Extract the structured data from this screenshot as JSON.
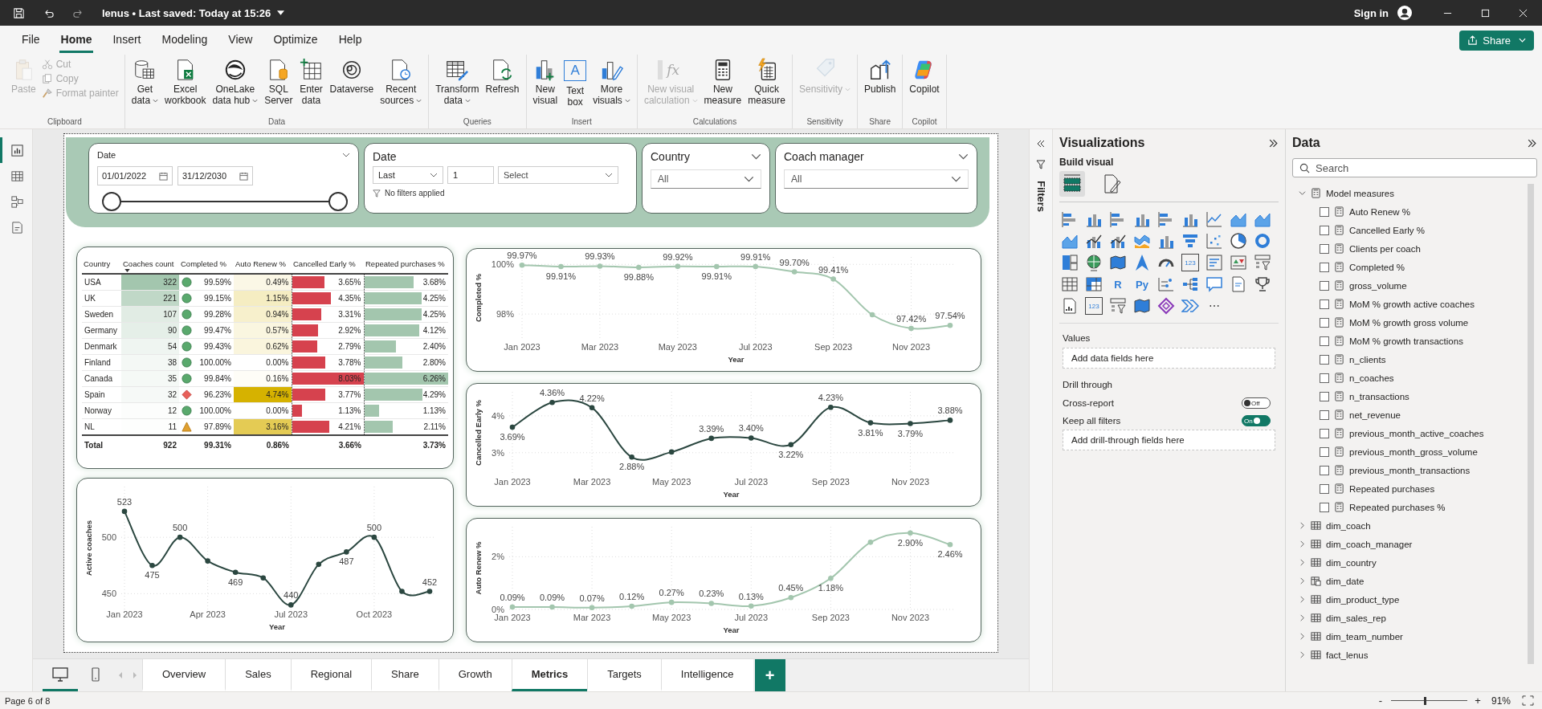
{
  "title_bar": {
    "title": "lenus • Last saved: Today at 15:26",
    "sign_in": "Sign in"
  },
  "menu_tabs": [
    {
      "label": "File",
      "selected": false
    },
    {
      "label": "Home",
      "selected": true
    },
    {
      "label": "Insert",
      "selected": false
    },
    {
      "label": "Modeling",
      "selected": false
    },
    {
      "label": "View",
      "selected": false
    },
    {
      "label": "Optimize",
      "selected": false
    },
    {
      "label": "Help",
      "selected": false
    }
  ],
  "share_button": "Share",
  "ribbon_groups": [
    {
      "label": "Clipboard",
      "buttons": [
        {
          "label": "Paste",
          "kind": "large",
          "disabled": true,
          "dropdown": false
        },
        {
          "label": "Cut",
          "kind": "small",
          "disabled": true,
          "dropdown": false
        },
        {
          "label": "Copy",
          "kind": "small",
          "disabled": true,
          "dropdown": false
        },
        {
          "label": "Format painter",
          "kind": "small",
          "disabled": true,
          "dropdown": false
        }
      ]
    },
    {
      "label": "Data",
      "buttons": [
        {
          "label": "Get\ndata",
          "kind": "large",
          "dropdown": true,
          "disabled": false
        },
        {
          "label": "Excel\nworkbook",
          "kind": "large",
          "dropdown": false,
          "disabled": false
        },
        {
          "label": "OneLake\ndata hub",
          "kind": "large",
          "dropdown": true,
          "disabled": false
        },
        {
          "label": "SQL\nServer",
          "kind": "large",
          "dropdown": false,
          "disabled": false
        },
        {
          "label": "Enter\ndata",
          "kind": "large",
          "dropdown": false,
          "disabled": false
        },
        {
          "label": "Dataverse",
          "kind": "large",
          "dropdown": false,
          "disabled": false
        },
        {
          "label": "Recent\nsources",
          "kind": "large",
          "dropdown": true,
          "disabled": false
        }
      ]
    },
    {
      "label": "Queries",
      "buttons": [
        {
          "label": "Transform\ndata",
          "kind": "large",
          "dropdown": true,
          "disabled": false
        },
        {
          "label": "Refresh",
          "kind": "large",
          "dropdown": false,
          "disabled": false
        }
      ]
    },
    {
      "label": "Insert",
      "buttons": [
        {
          "label": "New\nvisual",
          "kind": "large",
          "dropdown": false,
          "disabled": false
        },
        {
          "label": "Text\nbox",
          "kind": "large",
          "icon_text": "A",
          "dropdown": false,
          "disabled": false
        },
        {
          "label": "More\nvisuals",
          "kind": "large",
          "dropdown": true,
          "disabled": false
        }
      ]
    },
    {
      "label": "Calculations",
      "buttons": [
        {
          "label": "New visual\ncalculation",
          "kind": "large",
          "dropdown": true,
          "disabled": true,
          "icon_text": "fx"
        },
        {
          "label": "New\nmeasure",
          "kind": "large",
          "dropdown": false,
          "disabled": false
        },
        {
          "label": "Quick\nmeasure",
          "kind": "large",
          "dropdown": false,
          "disabled": false
        }
      ]
    },
    {
      "label": "Sensitivity",
      "buttons": [
        {
          "label": "Sensitivity",
          "kind": "large",
          "dropdown": true,
          "disabled": true
        }
      ]
    },
    {
      "label": "Share",
      "buttons": [
        {
          "label": "Publish",
          "kind": "large",
          "dropdown": false,
          "disabled": false
        }
      ]
    },
    {
      "label": "Copilot",
      "buttons": [
        {
          "label": "Copilot",
          "kind": "large",
          "dropdown": false,
          "disabled": false
        }
      ]
    }
  ],
  "view_rail": [
    {
      "selected": true
    },
    {
      "selected": false
    },
    {
      "selected": false
    },
    {
      "selected": false
    }
  ],
  "slicers": [
    {
      "kind": "date_range",
      "title": "Date",
      "start": "01/01/2022",
      "end": "31/12/2030",
      "range": {
        "level": 1
      }
    },
    {
      "kind": "relative_date",
      "title": "Date",
      "period": "Last",
      "count": "1",
      "unit_placeholder": "Select",
      "status": "No filters applied"
    },
    {
      "kind": "dropdown",
      "title": "Country",
      "value": "All"
    },
    {
      "kind": "dropdown",
      "title": "Coach manager",
      "value": "All"
    }
  ],
  "table": {
    "columns": [
      "Country",
      "Coaches count",
      "Completed %",
      "Auto Renew %",
      "Cancelled Early %",
      "Repeated purchases %"
    ],
    "rows": [
      {
        "country": "USA",
        "coaches": {
          "text": "322",
          "color": "#a3c6ae"
        },
        "completed": {
          "kind": "circle",
          "text": "99.59%"
        },
        "auto_renew": {
          "text": "0.49%",
          "color": "#fbf7e6"
        },
        "cancelled": {
          "text": "3.65%",
          "level": 0.45
        },
        "repeated": {
          "text": "3.68%",
          "level": 0.59
        }
      },
      {
        "country": "UK",
        "coaches": {
          "text": "221",
          "color": "#c0d8c7"
        },
        "completed": {
          "kind": "circle",
          "text": "99.15%"
        },
        "auto_renew": {
          "text": "1.15%",
          "color": "#f5edc2"
        },
        "cancelled": {
          "text": "4.35%",
          "level": 0.54
        },
        "repeated": {
          "text": "4.25%",
          "level": 0.68
        }
      },
      {
        "country": "Sweden",
        "coaches": {
          "text": "107",
          "color": "#e1ece4"
        },
        "completed": {
          "kind": "circle",
          "text": "99.28%"
        },
        "auto_renew": {
          "text": "0.94%",
          "color": "#f7f0cc"
        },
        "cancelled": {
          "text": "3.31%",
          "level": 0.41
        },
        "repeated": {
          "text": "4.25%",
          "level": 0.68
        }
      },
      {
        "country": "Germany",
        "coaches": {
          "text": "90",
          "color": "#e5efe8"
        },
        "completed": {
          "kind": "circle",
          "text": "99.47%"
        },
        "auto_renew": {
          "text": "0.57%",
          "color": "#faf6e0"
        },
        "cancelled": {
          "text": "2.92%",
          "level": 0.36
        },
        "repeated": {
          "text": "4.12%",
          "level": 0.66
        }
      },
      {
        "country": "Denmark",
        "coaches": {
          "text": "54",
          "color": "#eff5f1"
        },
        "completed": {
          "kind": "circle",
          "text": "99.43%"
        },
        "auto_renew": {
          "text": "0.62%",
          "color": "#faf5dd"
        },
        "cancelled": {
          "text": "2.79%",
          "level": 0.35
        },
        "repeated": {
          "text": "2.40%",
          "level": 0.38
        }
      },
      {
        "country": "Finland",
        "coaches": {
          "text": "38",
          "color": "#f4f8f5"
        },
        "completed": {
          "kind": "circle",
          "text": "100.00%"
        },
        "auto_renew": {
          "text": "0.00%",
          "color": "#ffffff"
        },
        "cancelled": {
          "text": "3.78%",
          "level": 0.47
        },
        "repeated": {
          "text": "2.80%",
          "level": 0.45
        }
      },
      {
        "country": "Canada",
        "coaches": {
          "text": "35",
          "color": "#f5f9f6"
        },
        "completed": {
          "kind": "circle",
          "text": "99.84%"
        },
        "auto_renew": {
          "text": "0.16%",
          "color": "#fefdf7"
        },
        "cancelled": {
          "text": "8.03%",
          "level": 1
        },
        "repeated": {
          "text": "6.26%",
          "level": 1
        }
      },
      {
        "country": "Spain",
        "coaches": {
          "text": "32",
          "color": "#f6f9f7"
        },
        "completed": {
          "kind": "diamond",
          "text": "96.23%"
        },
        "auto_renew": {
          "text": "4.74%",
          "color": "#d6b200"
        },
        "cancelled": {
          "text": "3.77%",
          "level": 0.47
        },
        "repeated": {
          "text": "4.29%",
          "level": 0.69
        }
      },
      {
        "country": "Norway",
        "coaches": {
          "text": "12",
          "color": "#fcfdfc"
        },
        "completed": {
          "kind": "circle",
          "text": "100.00%"
        },
        "auto_renew": {
          "text": "0.00%",
          "color": "#ffffff"
        },
        "cancelled": {
          "text": "1.13%",
          "level": 0.14
        },
        "repeated": {
          "text": "1.13%",
          "level": 0.18
        }
      },
      {
        "country": "NL",
        "coaches": {
          "text": "11",
          "color": "#fdfefd"
        },
        "completed": {
          "kind": "triangle",
          "text": "97.89%"
        },
        "auto_renew": {
          "text": "3.16%",
          "color": "#e4cb54"
        },
        "cancelled": {
          "text": "4.21%",
          "level": 0.52
        },
        "repeated": {
          "text": "2.11%",
          "level": 0.34
        }
      }
    ],
    "total": [
      "Total",
      "922",
      "99.31%",
      "0.86%",
      "3.66%",
      "3.73%"
    ]
  },
  "line_charts": [
    {
      "chart_data": {
        "type": "line",
        "xlabel": "Year",
        "ylabel": "Completed %",
        "grid": true,
        "categories": [
          "Jan 2023",
          null,
          "Mar 2023",
          null,
          "May 2023",
          null,
          "Jul 2023",
          null,
          "Sep 2023",
          null,
          "Nov 2023",
          null
        ],
        "series": [
          {
            "color": "#a3c6ae",
            "marker": true,
            "values": [
              99.97,
              99.91,
              99.93,
              99.88,
              99.92,
              99.91,
              99.91,
              99.7,
              99.41,
              97.97,
              97.42,
              97.54
            ]
          }
        ],
        "ylim": [
          97.0,
          100.3
        ],
        "yticks": [
          {
            "value": 98,
            "label": "98%"
          },
          {
            "value": 100,
            "label": "100%"
          }
        ],
        "value_labels": [
          "99.97%",
          "99.91%",
          "99.93%",
          "99.88%",
          "99.92%",
          "99.91%",
          "99.91%",
          "99.70%",
          "99.41%",
          null,
          "97.42%",
          "97.54%"
        ]
      }
    },
    {
      "chart_data": {
        "type": "line",
        "xlabel": "Year",
        "ylabel": "Cancelled Early %",
        "grid": true,
        "categories": [
          "Jan 2023",
          null,
          "Mar 2023",
          null,
          "May 2023",
          null,
          "Jul 2023",
          null,
          "Sep 2023",
          null,
          "Nov 2023",
          null
        ],
        "series": [
          {
            "color": "#2b4740",
            "marker": true,
            "values": [
              3.69,
              4.36,
              4.22,
              2.88,
              3.02,
              3.39,
              3.4,
              3.22,
              4.23,
              3.81,
              3.79,
              3.88
            ]
          }
        ],
        "ylim": [
          2.43,
          4.65
        ],
        "yticks": [
          {
            "value": 3,
            "label": "3%"
          },
          {
            "value": 4,
            "label": "4%"
          }
        ],
        "value_labels": [
          "3.69%",
          "4.36%",
          "4.22%",
          "2.88%",
          null,
          "3.39%",
          "3.40%",
          "3.22%",
          "4.23%",
          "3.81%",
          "3.79%",
          "3.88%"
        ]
      }
    },
    {
      "chart_data": {
        "type": "line",
        "xlabel": "Year",
        "ylabel": "Active coaches",
        "grid": true,
        "categories": [
          "Jan 2023",
          null,
          null,
          "Apr 2023",
          null,
          null,
          "Jul 2023",
          null,
          null,
          "Oct 2023",
          null,
          null
        ],
        "series": [
          {
            "color": "#2b4740",
            "marker": true,
            "values": [
              523,
              475,
              500,
              479,
              469,
              464,
              440,
              476,
              487,
              500,
              452,
              452
            ]
          }
        ],
        "ylim": [
          436,
          545
        ],
        "yticks": [
          {
            "value": 450,
            "label": "450"
          },
          {
            "value": 500,
            "label": "500"
          }
        ],
        "value_labels": [
          "523",
          "475",
          "500",
          null,
          "469",
          null,
          "440",
          null,
          "487",
          "500",
          null,
          "452"
        ]
      }
    },
    {
      "chart_data": {
        "type": "line",
        "xlabel": "Year",
        "ylabel": "Auto Renew %",
        "grid": true,
        "categories": [
          "Jan 2023",
          null,
          "Mar 2023",
          null,
          "May 2023",
          null,
          "Jul 2023",
          null,
          "Sep 2023",
          null,
          "Nov 2023",
          null
        ],
        "series": [
          {
            "color": "#a3c6ae",
            "marker": true,
            "values": [
              0.09,
              0.09,
              0.07,
              0.12,
              0.27,
              0.23,
              0.13,
              0.45,
              1.18,
              2.55,
              2.9,
              2.46
            ]
          }
        ],
        "ylim": [
          0,
          3.14
        ],
        "yticks": [
          {
            "value": 0,
            "label": "0%"
          },
          {
            "value": 2,
            "label": "2%"
          }
        ],
        "value_labels": [
          "0.09%",
          "0.09%",
          "0.07%",
          "0.12%",
          "0.27%",
          "0.23%",
          "0.13%",
          "0.45%",
          "1.18%",
          null,
          "2.90%",
          "2.46%"
        ]
      }
    }
  ],
  "filters_pane": {
    "label": "Filters"
  },
  "visualizations": {
    "title": "Visualizations",
    "subtitle": "Build visual",
    "build_tabs": [
      {
        "selected": true
      },
      {
        "selected": false
      }
    ],
    "visual_types": [
      {
        "kind": "hbar"
      },
      {
        "kind": "col"
      },
      {
        "kind": "hbar"
      },
      {
        "kind": "col"
      },
      {
        "kind": "hbar"
      },
      {
        "kind": "col"
      },
      {
        "kind": "line"
      },
      {
        "kind": "area"
      },
      {
        "kind": "area"
      },
      {
        "kind": "area"
      },
      {
        "kind": "combo"
      },
      {
        "kind": "combo"
      },
      {
        "kind": "ribbon"
      },
      {
        "kind": "col"
      },
      {
        "kind": "funnel"
      },
      {
        "kind": "scatter"
      },
      {
        "kind": "pie"
      },
      {
        "kind": "donut"
      },
      {
        "kind": "treemap"
      },
      {
        "kind": "globe"
      },
      {
        "kind": "map"
      },
      {
        "kind": "arrow"
      },
      {
        "kind": "gauge"
      },
      {
        "kind": "card",
        "text": "123"
      },
      {
        "kind": "lines"
      },
      {
        "kind": "kpi"
      },
      {
        "kind": "slicer"
      },
      {
        "kind": "table"
      },
      {
        "kind": "matrix"
      },
      {
        "kind": "letter",
        "text": "R"
      },
      {
        "kind": "letter",
        "text": "Py"
      },
      {
        "kind": "keyinf"
      },
      {
        "kind": "tree"
      },
      {
        "kind": "bubble"
      },
      {
        "kind": "doc"
      },
      {
        "kind": "trophy"
      },
      {
        "kind": "report"
      },
      {
        "kind": "card",
        "text": "123"
      },
      {
        "kind": "slicer"
      },
      {
        "kind": "map"
      },
      {
        "kind": "diamond"
      },
      {
        "kind": "chevrons"
      },
      {
        "kind": "more",
        "text": "⋯"
      }
    ],
    "values_label": "Values",
    "values_drop": "Add data fields here",
    "drill_label": "Drill through",
    "toggles": [
      {
        "label": "Cross-report",
        "on": false,
        "state": "Off"
      },
      {
        "label": "Keep all filters",
        "on": true,
        "state": "On"
      }
    ],
    "drill_drop": "Add drill-through fields here"
  },
  "data_pane": {
    "title": "Data",
    "search_placeholder": "Search",
    "tree": [
      {
        "label": "Model measures",
        "kind": "measures",
        "expanded": true,
        "children": [
          {
            "label": "Auto Renew %",
            "checked": false
          },
          {
            "label": "Cancelled Early %",
            "checked": false
          },
          {
            "label": "Clients per coach",
            "checked": false
          },
          {
            "label": "Completed %",
            "checked": false
          },
          {
            "label": "gross_volume",
            "checked": false
          },
          {
            "label": "MoM % growth active coaches",
            "checked": false
          },
          {
            "label": "MoM % growth gross volume",
            "checked": false
          },
          {
            "label": "MoM % growth transactions",
            "checked": false
          },
          {
            "label": "n_clients",
            "checked": false
          },
          {
            "label": "n_coaches",
            "checked": false
          },
          {
            "label": "n_transactions",
            "checked": false
          },
          {
            "label": "net_revenue",
            "checked": false
          },
          {
            "label": "previous_month_active_coaches",
            "checked": false
          },
          {
            "label": "previous_month_gross_volume",
            "checked": false
          },
          {
            "label": "previous_month_transactions",
            "checked": false
          },
          {
            "label": "Repeated purchases",
            "checked": false
          },
          {
            "label": "Repeated purchases %",
            "checked": false
          }
        ]
      },
      {
        "label": "dim_coach",
        "kind": "table",
        "expanded": false
      },
      {
        "label": "dim_coach_manager",
        "kind": "table",
        "expanded": false
      },
      {
        "label": "dim_country",
        "kind": "table",
        "expanded": false
      },
      {
        "label": "dim_date",
        "kind": "date_table",
        "expanded": false
      },
      {
        "label": "dim_product_type",
        "kind": "table",
        "expanded": false
      },
      {
        "label": "dim_sales_rep",
        "kind": "table",
        "expanded": false
      },
      {
        "label": "dim_team_number",
        "kind": "table",
        "expanded": false
      },
      {
        "label": "fact_lenus",
        "kind": "table",
        "expanded": false
      }
    ]
  },
  "page_tabs": {
    "views": [
      {
        "selected": true
      },
      {
        "selected": false
      }
    ],
    "tabs": [
      {
        "label": "Overview",
        "selected": false
      },
      {
        "label": "Sales",
        "selected": false
      },
      {
        "label": "Regional",
        "selected": false
      },
      {
        "label": "Share",
        "selected": false
      },
      {
        "label": "Growth",
        "selected": false
      },
      {
        "label": "Metrics",
        "selected": true
      },
      {
        "label": "Targets",
        "selected": false
      },
      {
        "label": "Intelligence",
        "selected": false
      }
    ],
    "add": "+"
  },
  "status_bar": {
    "page": "Page 6 of 8",
    "zoom_out": "-",
    "zoom_in": "+",
    "zoom": "91%",
    "zoom_slider": {
      "level": 0.45
    }
  }
}
